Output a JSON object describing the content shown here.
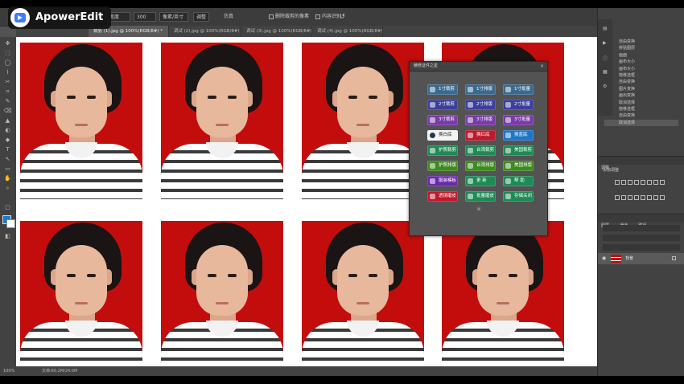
{
  "watermark": {
    "text": "ApowerEdit"
  },
  "options_bar": {
    "field1": "宽度",
    "field2": "300",
    "field3": "像素/英寸",
    "button1": "调整",
    "button2": "仿真",
    "label_sel": "删除裁剪的像素",
    "label_fill": "内容识别"
  },
  "doc_tabs": [
    {
      "label": "裁剪 (1).jpg @ 100%(RGB/8#) *"
    },
    {
      "label": "调试 (2).jpg @ 100%(RGB/8#) *"
    },
    {
      "label": "调试 (3).jpg @ 100%(RGB/8#)"
    },
    {
      "label": "调试 (4).jpg @ 100%(RGB/8#)"
    }
  ],
  "dialog": {
    "title": "精修证件之星",
    "close": "×",
    "buttons": [
      {
        "label": "1寸裁剪",
        "color": "#3b6a8f"
      },
      {
        "label": "1寸排版",
        "color": "#3b6a8f"
      },
      {
        "label": "1寸批量",
        "color": "#3b6a8f"
      },
      {
        "label": "2寸裁剪",
        "color": "#3a3f9c"
      },
      {
        "label": "2寸排版",
        "color": "#3a3f9c"
      },
      {
        "label": "2寸批量",
        "color": "#3a3f9c"
      },
      {
        "label": "3寸裁剪",
        "color": "#7a3aa8"
      },
      {
        "label": "3寸排版",
        "color": "#7a3aa8"
      },
      {
        "label": "3寸批量",
        "color": "#7a3aa8"
      },
      {
        "label": "换白底",
        "color": "#f4f4f4"
      },
      {
        "label": "换红底",
        "color": "#c0182c"
      },
      {
        "label": "换蓝底",
        "color": "#1e76c8"
      },
      {
        "label": "护照裁剪",
        "color": "#1f8a55"
      },
      {
        "label": "台湾裁剪",
        "color": "#1f8a55"
      },
      {
        "label": "美国裁剪",
        "color": "#1f8a55"
      },
      {
        "label": "护照排版",
        "color": "#3f8a1f"
      },
      {
        "label": "台湾排版",
        "color": "#3f8a1f"
      },
      {
        "label": "美国排版",
        "color": "#3f8a1f"
      },
      {
        "label": "服装模板",
        "color": "#6a2aa8"
      },
      {
        "label": "更 新",
        "color": "#1f8a55"
      },
      {
        "label": "帮 助",
        "color": "#1f8a55"
      },
      {
        "label": "透镜磨皮",
        "color": "#c0182c"
      },
      {
        "label": "批量磨皮",
        "color": "#1f8a55"
      },
      {
        "label": "存储关闭",
        "color": "#1f8a55"
      }
    ],
    "bottom_icon": "✳"
  },
  "history": [
    {
      "label": "自由变换"
    },
    {
      "label": "拼贴图层"
    },
    {
      "label": "画面"
    },
    {
      "label": "画布大小"
    },
    {
      "label": "画布大小"
    },
    {
      "label": "拖移选框"
    },
    {
      "label": "自由变换"
    },
    {
      "label": "图片变换"
    },
    {
      "label": "画出变换"
    },
    {
      "label": "取消选择"
    },
    {
      "label": "拖移选框"
    },
    {
      "label": "自由变换"
    },
    {
      "label": "取消选择"
    }
  ],
  "adjust_panel": {
    "tab": "调整",
    "subtitle": "添加调整"
  },
  "layers_panel": {
    "tabs": [
      "图层",
      "通道",
      "路径"
    ],
    "layer_name": "背景"
  },
  "statusbar": {
    "zoom": "100%",
    "doc": "文档:60.2M/24.0M"
  },
  "tools": [
    "✥",
    "⬚",
    "◯",
    "⌇",
    "✂",
    "⌗",
    "✎",
    "⌫",
    "▲",
    "◐",
    "◆",
    "T",
    "↖",
    "▭",
    "✋",
    "⌕",
    "▢",
    "◧"
  ],
  "colors": {
    "photo_bg": "#c30d0d"
  }
}
